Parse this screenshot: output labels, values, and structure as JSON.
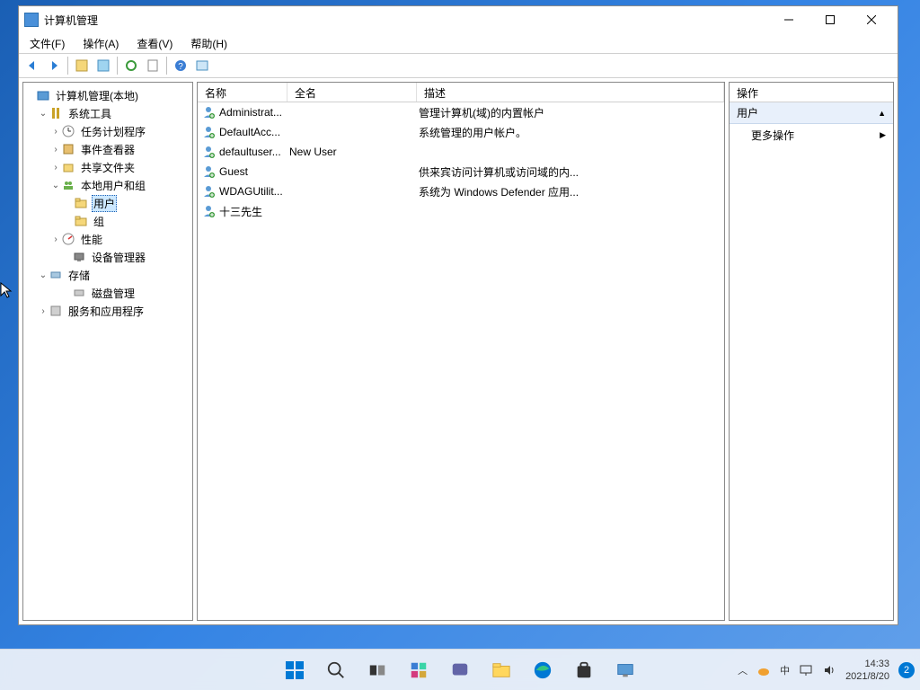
{
  "window": {
    "title": "计算机管理"
  },
  "menubar": [
    "文件(F)",
    "操作(A)",
    "查看(V)",
    "帮助(H)"
  ],
  "tree": {
    "root": "计算机管理(本地)",
    "system_tools": "系统工具",
    "task_scheduler": "任务计划程序",
    "event_viewer": "事件查看器",
    "shared_folders": "共享文件夹",
    "local_users_groups": "本地用户和组",
    "users": "用户",
    "groups": "组",
    "performance": "性能",
    "device_manager": "设备管理器",
    "storage": "存储",
    "disk_management": "磁盘管理",
    "services_apps": "服务和应用程序"
  },
  "list": {
    "headers": {
      "name": "名称",
      "full": "全名",
      "desc": "描述"
    },
    "rows": [
      {
        "name": "Administrat...",
        "full": "",
        "desc": "管理计算机(域)的内置帐户"
      },
      {
        "name": "DefaultAcc...",
        "full": "",
        "desc": "系统管理的用户帐户。"
      },
      {
        "name": "defaultuser...",
        "full": "New User",
        "desc": ""
      },
      {
        "name": "Guest",
        "full": "",
        "desc": "供来宾访问计算机或访问域的内..."
      },
      {
        "name": "WDAGUtilit...",
        "full": "",
        "desc": "系统为 Windows Defender 应用..."
      },
      {
        "name": "十三先生",
        "full": "",
        "desc": ""
      }
    ]
  },
  "actions": {
    "header": "操作",
    "section": "用户",
    "more": "更多操作"
  },
  "taskbar": {
    "time": "14:33",
    "date": "2021/8/20",
    "ime": "中",
    "notification_count": "2"
  }
}
